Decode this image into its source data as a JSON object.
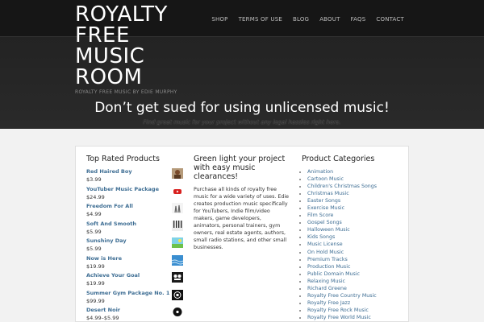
{
  "site": {
    "title": "ROYALTY FREE MUSIC ROOM",
    "title_lines": [
      "ROYALTY",
      "FREE",
      "MUSIC",
      "ROOM"
    ],
    "tagline": "ROYALTY FREE MUSIC BY EDIE MURPHY"
  },
  "nav": [
    "SHOP",
    "TERMS OF USE",
    "BLOG",
    "ABOUT",
    "FAQS",
    "CONTACT"
  ],
  "hero": {
    "title": "Don’t get sued for using unlicensed music!",
    "subtitle": "Find great music for your project without any legal hassles right here."
  },
  "top_rated": {
    "heading": "Top Rated Products",
    "items": [
      {
        "name": "Red Haired Boy",
        "price": "$3.99",
        "icon": "portrait-thumb"
      },
      {
        "name": "YouTuber Music Package",
        "price": "$24.99",
        "icon": "youtube-thumb"
      },
      {
        "name": "Freedom For All",
        "price": "$4.99",
        "icon": "hands-thumb"
      },
      {
        "name": "Soft And Smooth",
        "price": "$5.99",
        "icon": "piano-keys-thumb"
      },
      {
        "name": "Sunshiny Day",
        "price": "$5.99",
        "icon": "sunny-landscape-thumb"
      },
      {
        "name": "Now is Here",
        "price": "$19.99",
        "icon": "water-thumb"
      },
      {
        "name": "Achieve Your Goal",
        "price": "$19.99",
        "icon": "team-thumb"
      },
      {
        "name": "Summer Gym Package No. 1",
        "price": "$99.99",
        "icon": "gym-thumb"
      },
      {
        "name": "Desert Noir",
        "price": "$4.99–$5.99",
        "icon": "record-thumb"
      }
    ]
  },
  "promo": {
    "heading": "Green light your project with easy music clearances!",
    "body": "Purchase all kinds of royalty free music for a wide variety of uses. Edie creates production music specifically for YouTubers, Indie film/video makers, game developers, animators, personal trainers, gym owners, real estate agents, authors, small radio stations, and other small businesses."
  },
  "categories": {
    "heading": "Product Categories",
    "items": [
      "Animation",
      "Cartoon Music",
      "Children's Christmas Songs",
      "Christmas Music",
      "Easter Songs",
      "Exercise Music",
      "Film Score",
      "Gospel Songs",
      "Halloween Music",
      "Kids Songs",
      "Music License",
      "On Hold Music",
      "Premium Tracks",
      "Production Music",
      "Public Domain Music",
      "Relaxing Music",
      "Richard Greene",
      "Royalty Free Country Music",
      "Royalty Free Jazz",
      "Royalty Free Rock Music",
      "Royalty Free World Music"
    ]
  },
  "colors": {
    "link": "#3d6d93",
    "header_bg": "#1c1c1c",
    "page_bg": "#f2f2f2"
  }
}
